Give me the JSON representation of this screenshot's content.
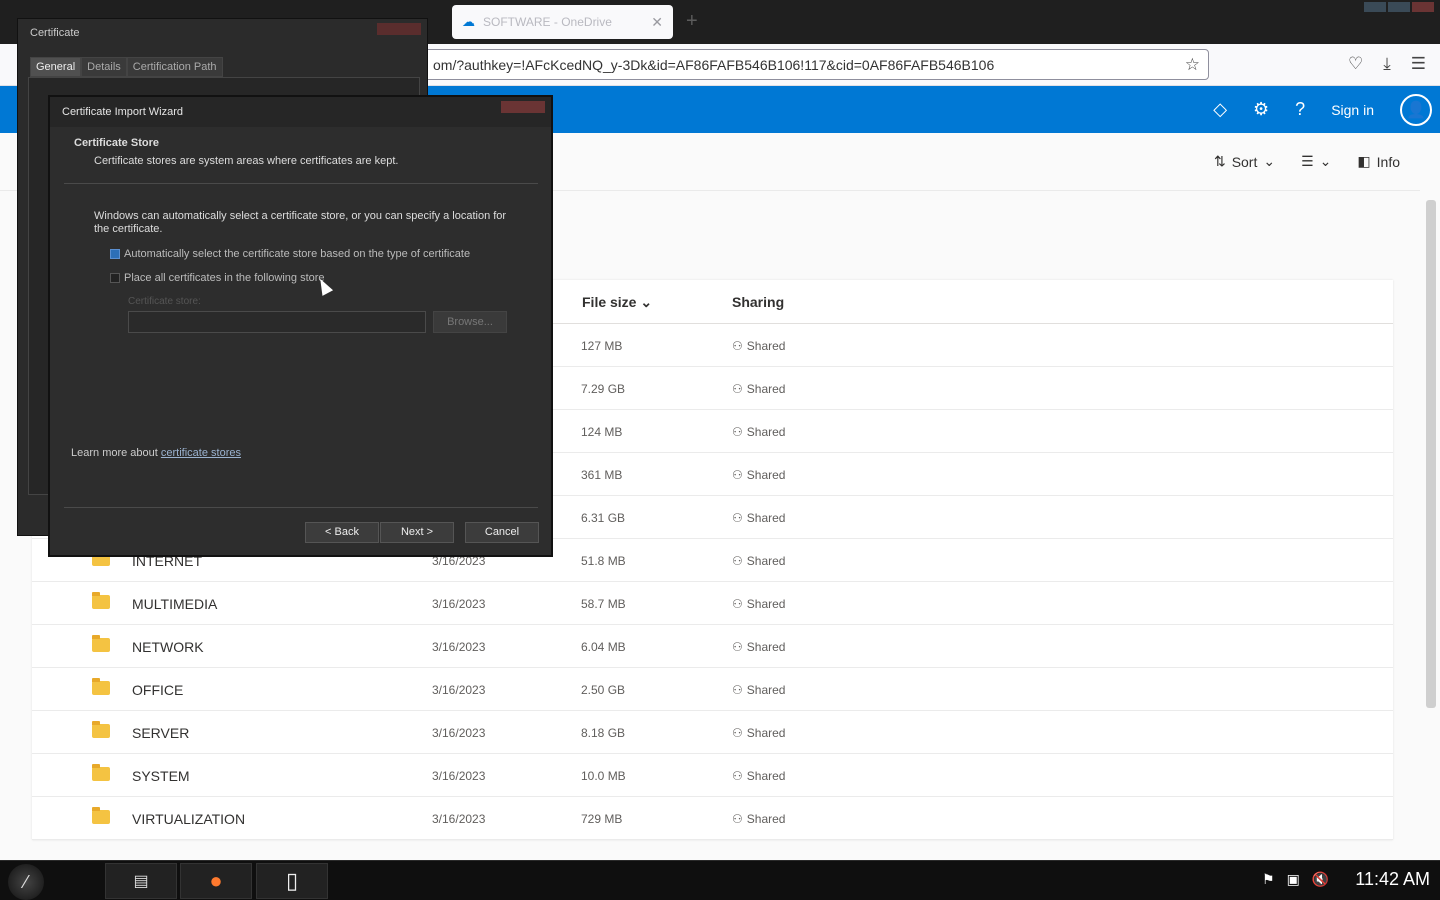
{
  "browser": {
    "tab_title": "SOFTWARE - OneDrive",
    "url": "om/?authkey=!AFcKcedNQ_y-3Dk&id=AF86FAFB546B106!117&cid=0AF86FAFB546B106"
  },
  "header": {
    "signin": "Sign in"
  },
  "toolbar": {
    "sort": "Sort",
    "info": "Info"
  },
  "columns": {
    "size": "File size",
    "sharing": "Sharing"
  },
  "rows": [
    {
      "name": "",
      "date": "",
      "size": "127 MB",
      "sharing": "Shared"
    },
    {
      "name": "",
      "date": "",
      "size": "7.29 GB",
      "sharing": "Shared"
    },
    {
      "name": "",
      "date": "",
      "size": "124 MB",
      "sharing": "Shared"
    },
    {
      "name": "",
      "date": "",
      "size": "361 MB",
      "sharing": "Shared"
    },
    {
      "name": "",
      "date": "",
      "size": "6.31 GB",
      "sharing": "Shared"
    },
    {
      "name": "INTERNET",
      "date": "3/16/2023",
      "size": "51.8 MB",
      "sharing": "Shared"
    },
    {
      "name": "MULTIMEDIA",
      "date": "3/16/2023",
      "size": "58.7 MB",
      "sharing": "Shared"
    },
    {
      "name": "NETWORK",
      "date": "3/16/2023",
      "size": "6.04 MB",
      "sharing": "Shared"
    },
    {
      "name": "OFFICE",
      "date": "3/16/2023",
      "size": "2.50 GB",
      "sharing": "Shared"
    },
    {
      "name": "SERVER",
      "date": "3/16/2023",
      "size": "8.18 GB",
      "sharing": "Shared"
    },
    {
      "name": "SYSTEM",
      "date": "3/16/2023",
      "size": "10.0 MB",
      "sharing": "Shared"
    },
    {
      "name": "VIRTUALIZATION",
      "date": "3/16/2023",
      "size": "729 MB",
      "sharing": "Shared"
    }
  ],
  "cert_window": {
    "title": "Certificate",
    "tabs": [
      "General",
      "Details",
      "Certification Path"
    ]
  },
  "wizard": {
    "title": "Certificate Import Wizard",
    "section_title": "Certificate Store",
    "section_subtitle": "Certificate stores are system areas where certificates are kept.",
    "description": "Windows can automatically select a certificate store, or you can specify a location for the certificate.",
    "option_auto": "Automatically select the certificate store based on the type of certificate",
    "option_manual": "Place all certificates in the following store",
    "store_label": "Certificate store:",
    "browse": "Browse...",
    "learn_prefix": "Learn more about ",
    "learn_link": "certificate stores",
    "back": "< Back",
    "next": "Next >",
    "cancel": "Cancel"
  },
  "taskbar": {
    "clock": "11:42 AM"
  }
}
